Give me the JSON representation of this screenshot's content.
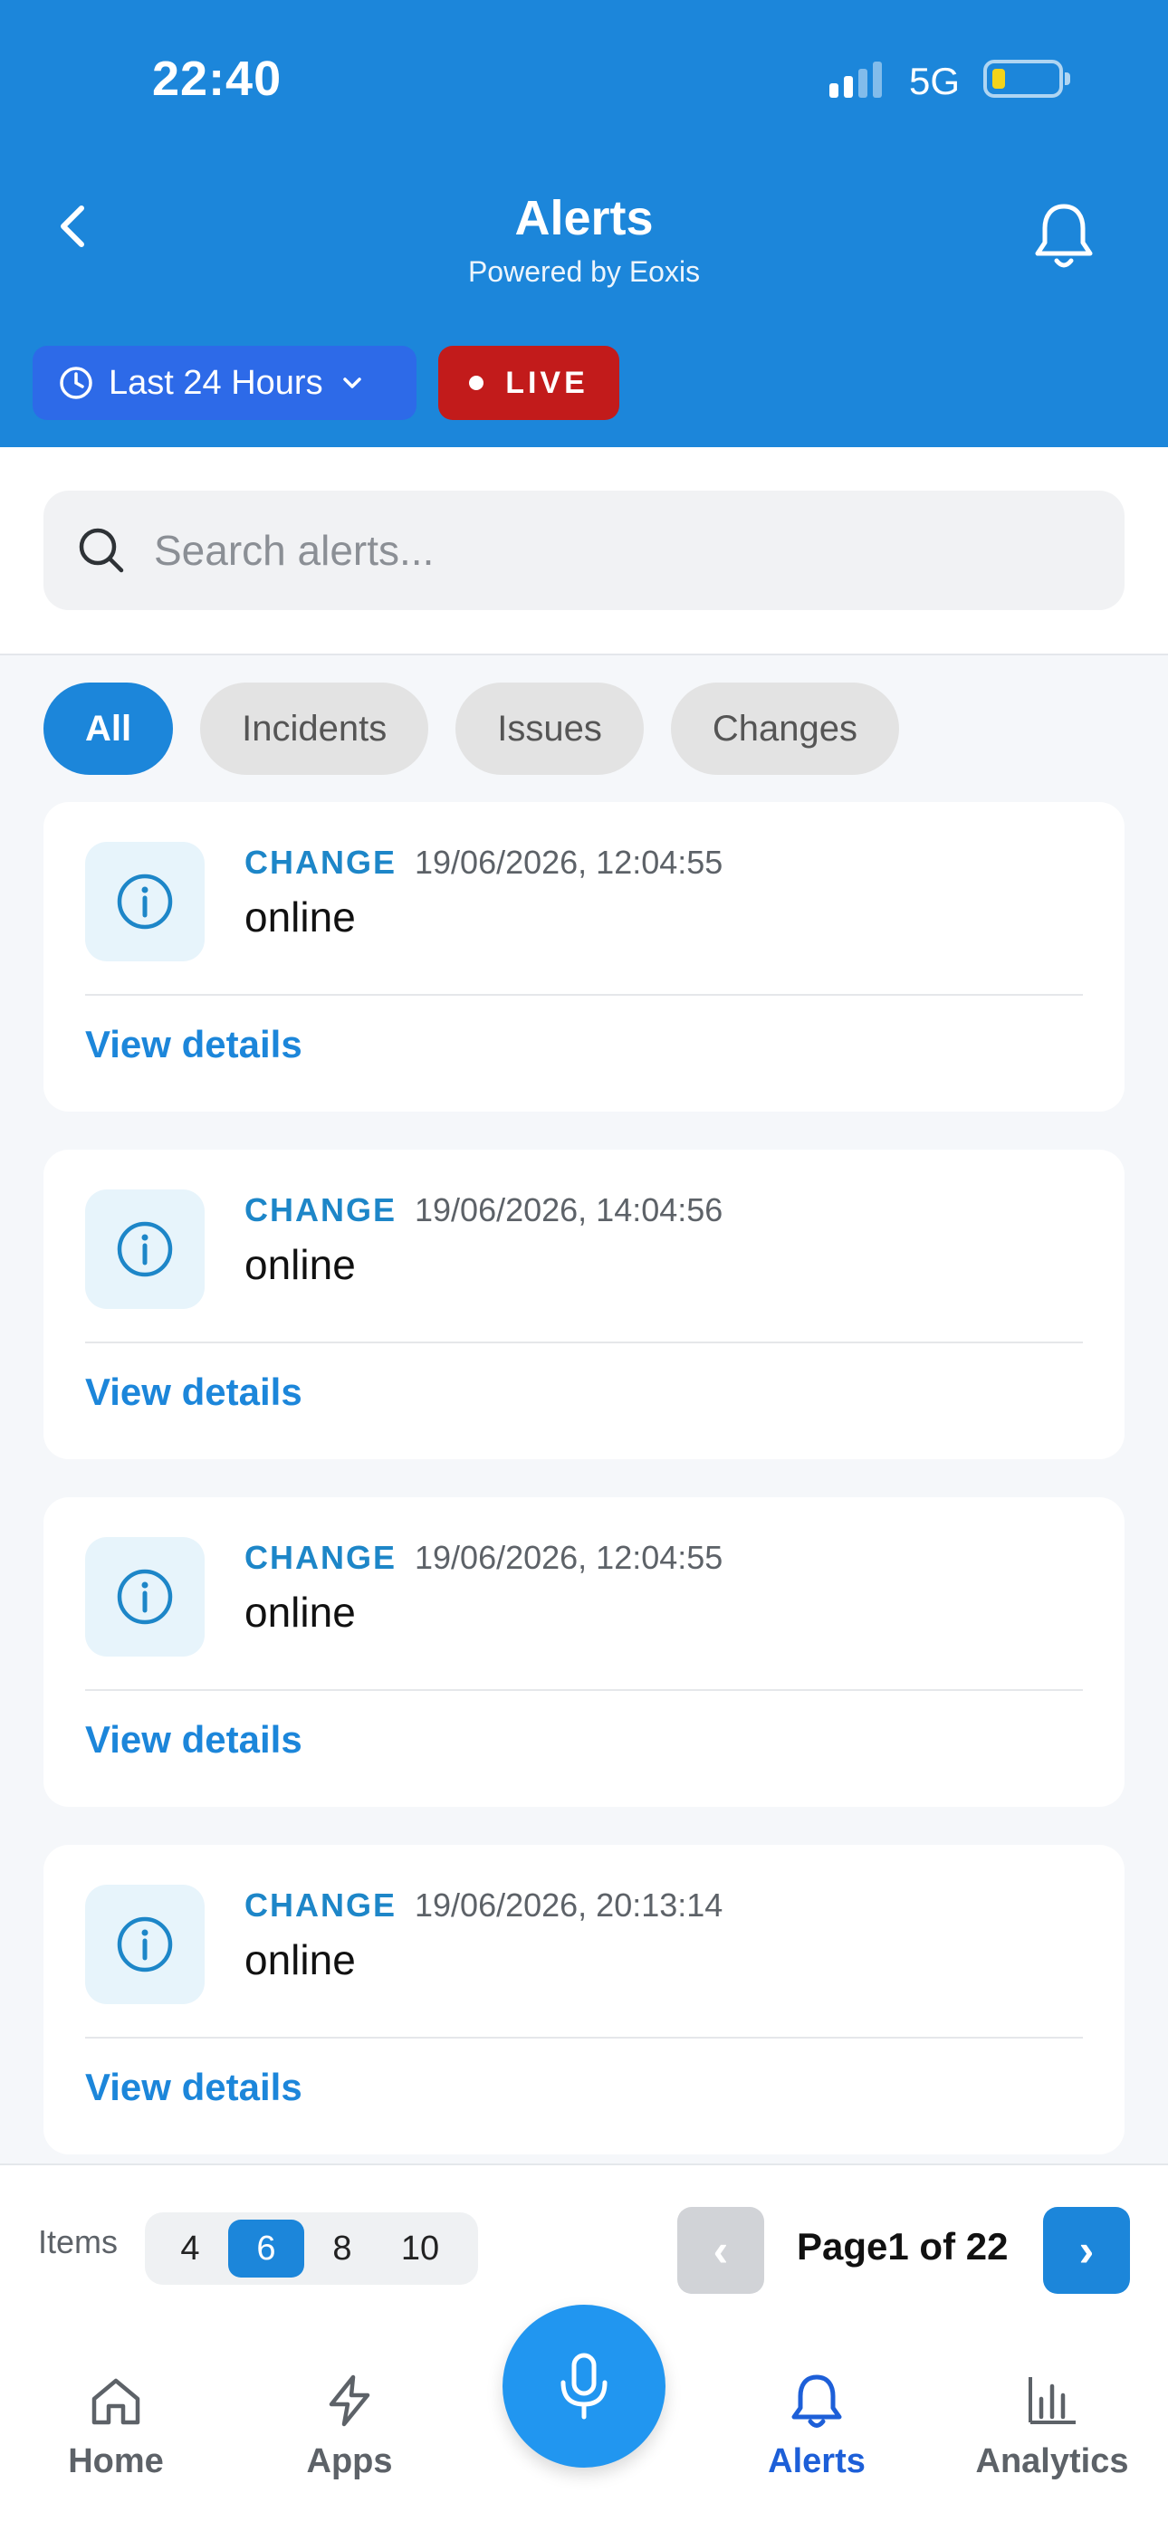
{
  "status_bar": {
    "time": "22:40",
    "network": "5G"
  },
  "header": {
    "title": "Alerts",
    "subtitle": "Powered by Eoxis",
    "time_range_label": "Last 24 Hours",
    "live_label": "LIVE"
  },
  "search": {
    "placeholder": "Search alerts..."
  },
  "filters": [
    {
      "label": "All",
      "active": true
    },
    {
      "label": "Incidents",
      "active": false
    },
    {
      "label": "Issues",
      "active": false
    },
    {
      "label": "Changes",
      "active": false
    }
  ],
  "alerts": [
    {
      "type": "CHANGE",
      "timestamp": "19/06/2026, 12:04:55",
      "title": "online",
      "link": "View details"
    },
    {
      "type": "CHANGE",
      "timestamp": "19/06/2026, 14:04:56",
      "title": "online",
      "link": "View details"
    },
    {
      "type": "CHANGE",
      "timestamp": "19/06/2026, 12:04:55",
      "title": "online",
      "link": "View details"
    },
    {
      "type": "CHANGE",
      "timestamp": "19/06/2026, 20:13:14",
      "title": "online",
      "link": "View details"
    }
  ],
  "pagination": {
    "items_label": "Items",
    "items_options": [
      "4",
      "6",
      "8",
      "10"
    ],
    "items_selected": "6",
    "prev_label": "‹",
    "next_label": "›",
    "page_text": "Page1 of 22"
  },
  "nav": {
    "home": "Home",
    "apps": "Apps",
    "alerts": "Alerts",
    "analytics": "Analytics"
  },
  "colors": {
    "header_blue": "#1c86da",
    "accent_blue": "#1c86da",
    "live_red": "#c21b1b",
    "active_nav": "#1d5fd8"
  }
}
